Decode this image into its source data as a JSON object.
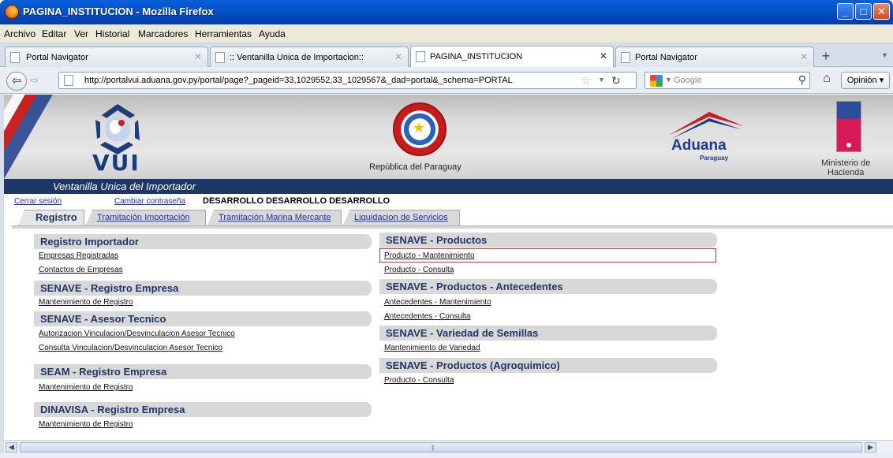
{
  "window": {
    "title": "PAGINA_INSTITUCION - Mozilla Firefox"
  },
  "menu": [
    "Archivo",
    "Editar",
    "Ver",
    "Historial",
    "Marcadores",
    "Herramientas",
    "Ayuda"
  ],
  "tabs": [
    {
      "label": "Portal Navigator"
    },
    {
      "label": ":: Ventanilla Unica de Importacion::"
    },
    {
      "label": "PAGINA_INSTITUCION"
    },
    {
      "label": "Portal Navigator"
    }
  ],
  "nav": {
    "url": "http://portalvui.aduana.gov.py/portal/page?_pageid=33,1029552,33_1029567&_dad=portal&_schema=PORTAL",
    "search_placeholder": "Google",
    "opinion_label": "Opinión"
  },
  "banner": {
    "vui": "VUI",
    "republica": "República del Paraguay",
    "aduana": "Aduana",
    "paraguay": "Paraguay",
    "ministerio_line1": "Ministerio de",
    "ministerio_line2": "Hacienda",
    "subtitle": "Ventanilla Unica del Importador"
  },
  "session": {
    "logout": "Cerrar sesión",
    "change_password": "Cambiar contraseña",
    "user": "DESARROLLO DESARROLLO DESARROLLO"
  },
  "page_tabs": [
    "Registro",
    "Tramitación Importación",
    "Tramitación Marina Mercante",
    "Liquidacion de Servicios"
  ],
  "left_sections": [
    {
      "title": "Registro Importador",
      "links": [
        "Empresas Registradas",
        "Contactos de Empresas"
      ]
    },
    {
      "title": "SENAVE - Registro Empresa",
      "links": [
        "Mantenimiento de Registro"
      ]
    },
    {
      "title": "SENAVE - Asesor Tecnico",
      "links": [
        "Autorizacion Vinculacion/Desvinculacion Asesor Tecnico",
        "Consulta Vinculacion/Desvinculacion Asesor Tecnico"
      ]
    },
    {
      "title": "SEAM - Registro Empresa",
      "links": [
        "Mantenimiento de Registro"
      ]
    },
    {
      "title": "DINAVISA - Registro Empresa",
      "links": [
        "Mantenimiento de Registro"
      ]
    }
  ],
  "right_sections": [
    {
      "title": "SENAVE - Productos",
      "links": [
        "Producto - Mantenimiento",
        "Producto - Consulta"
      ]
    },
    {
      "title": "SENAVE - Productos - Antecedentes",
      "links": [
        "Antecedentes - Mantenimiento",
        "Antecedentes - Consulta"
      ]
    },
    {
      "title": "SENAVE - Variedad de Semillas",
      "links": [
        "Mantenimiento de Variedad"
      ]
    },
    {
      "title": "SENAVE - Productos (Agroquimico)",
      "links": [
        "Producto - Consulta"
      ]
    }
  ]
}
